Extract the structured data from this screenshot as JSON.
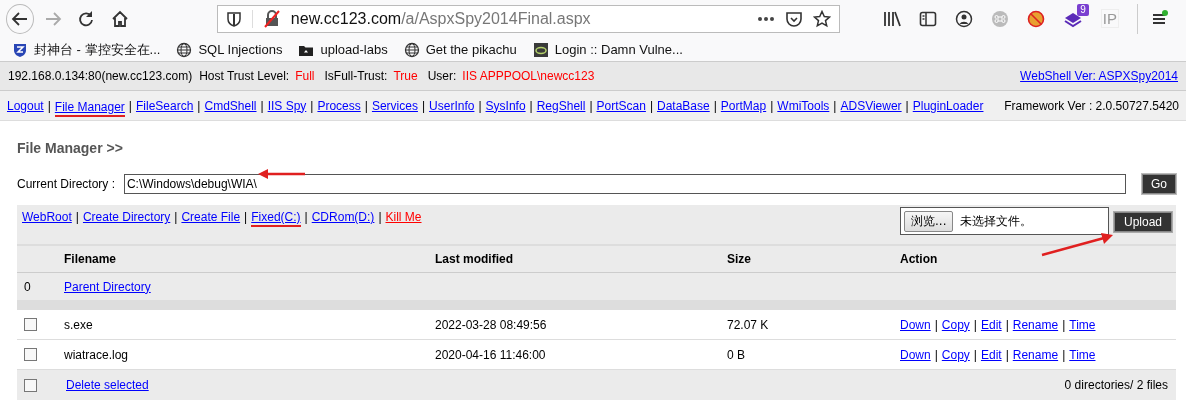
{
  "browser": {
    "url_host": "new.cc123.com",
    "url_path": "/a/AspxSpy2014Final.aspx",
    "extension_badge": "9",
    "ip_label": "IP",
    "bookmarks": [
      {
        "label": "封神台 - 掌控安全在...",
        "kind": "shield"
      },
      {
        "label": "SQL Injections",
        "kind": "globe"
      },
      {
        "label": "upload-labs",
        "kind": "folder"
      },
      {
        "label": "Get the pikachu",
        "kind": "globe"
      },
      {
        "label": "Login :: Damn Vulne...",
        "kind": "logo"
      }
    ]
  },
  "info_bar": {
    "host": "192.168.0.134:80(new.cc123.com)",
    "trust_label": "Host Trust Level:",
    "trust_value": "Full",
    "full_trust_label": "IsFull-Trust:",
    "full_trust_value": "True",
    "user_label": "User:",
    "user_value": "IIS APPPOOL\\newcc123",
    "version_link": "WebShell Ver: ASPXSpy2014"
  },
  "nav": {
    "separator": "|",
    "framework": "Framework Ver : 2.0.50727.5420",
    "items": [
      {
        "label": "Logout",
        "marked": false
      },
      {
        "label": "File Manager",
        "marked": true
      },
      {
        "label": "FileSearch",
        "marked": false
      },
      {
        "label": "CmdShell",
        "marked": false
      },
      {
        "label": "IIS Spy",
        "marked": false
      },
      {
        "label": "Process",
        "marked": false
      },
      {
        "label": "Services",
        "marked": false
      },
      {
        "label": "UserInfo",
        "marked": false
      },
      {
        "label": "SysInfo",
        "marked": false
      },
      {
        "label": "RegShell",
        "marked": false
      },
      {
        "label": "PortScan",
        "marked": false
      },
      {
        "label": "DataBase",
        "marked": false
      },
      {
        "label": "PortMap",
        "marked": false
      },
      {
        "label": "WmiTools",
        "marked": false
      },
      {
        "label": "ADSViewer",
        "marked": false
      },
      {
        "label": "PluginLoader",
        "marked": false
      }
    ]
  },
  "file_manager": {
    "title": "File Manager >>",
    "directory_label": "Current Directory :",
    "directory_value": "C:\\Windows\\debug\\WIA\\",
    "directory_arrow": true,
    "go": "Go",
    "separator": "|",
    "links": [
      {
        "label": "WebRoot",
        "kind": "link",
        "marked": false
      },
      {
        "label": "Create Directory",
        "kind": "link",
        "marked": false
      },
      {
        "label": "Create File",
        "kind": "link",
        "marked": false
      },
      {
        "label": "Fixed(C:)",
        "kind": "link",
        "marked": true
      },
      {
        "label": "CDRom(D:)",
        "kind": "link",
        "marked": false
      },
      {
        "label": "Kill Me",
        "kind": "danger",
        "marked": false
      }
    ],
    "browse": "浏览...",
    "no_file": "未选择文件。",
    "upload": "Upload",
    "upload_arrow": true,
    "columns": [
      "Filename",
      "Last modified",
      "Size",
      "Action"
    ],
    "parent": {
      "index": "0",
      "label": "Parent Directory"
    },
    "files": [
      {
        "name": "s.exe",
        "modified": "2022-03-28 08:49:56",
        "size": "72.07 K",
        "checked": false,
        "actions": [
          "Down",
          "Copy",
          "Edit",
          "Rename",
          "Time"
        ]
      },
      {
        "name": "wiatrace.log",
        "modified": "2020-04-16 11:46:00",
        "size": "0 B",
        "checked": false,
        "actions": [
          "Down",
          "Copy",
          "Edit",
          "Rename",
          "Time"
        ]
      }
    ],
    "delete_label": "Delete selected",
    "delete_checked": false,
    "summary": "0 directories/ 2 files"
  }
}
